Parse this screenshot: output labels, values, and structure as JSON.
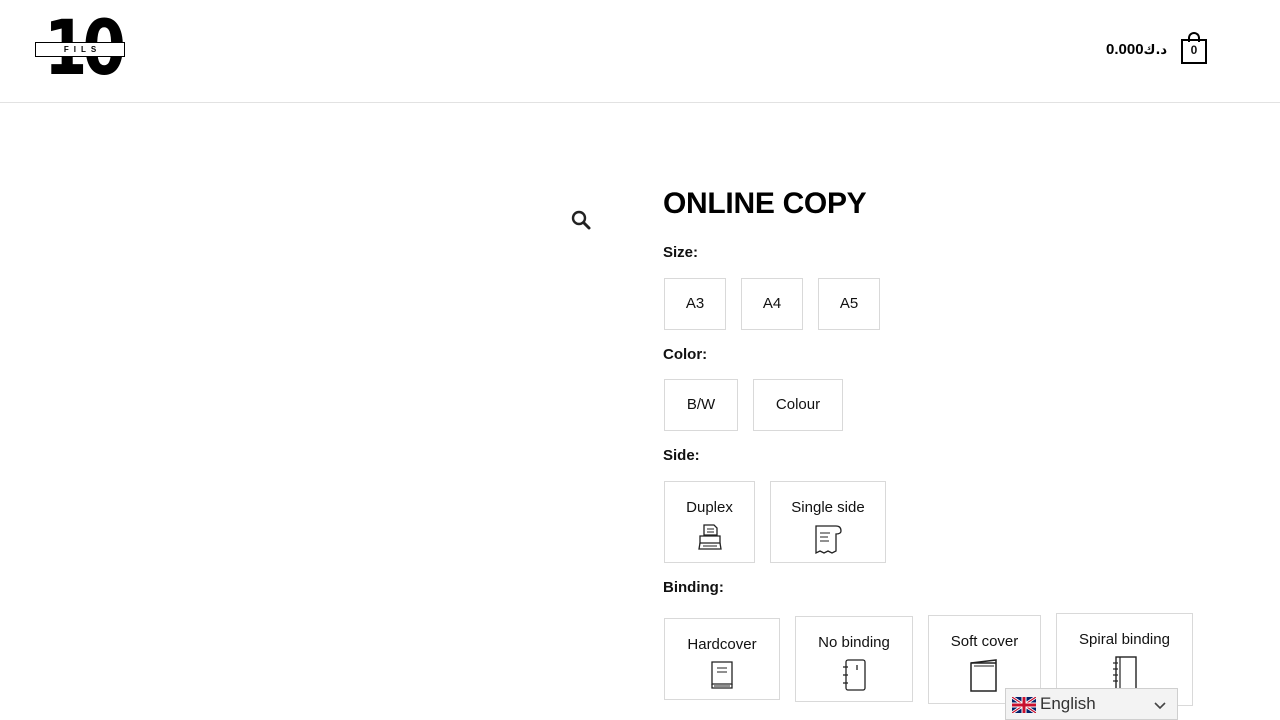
{
  "header": {
    "logo": {
      "digits": "10",
      "word": "FILS"
    },
    "cart": {
      "total": "0.000",
      "currency": "د.ك",
      "count": "0"
    }
  },
  "product": {
    "title": "ONLINE COPY",
    "attributes": {
      "size": {
        "label": "Size:",
        "options": [
          "A3",
          "A4",
          "A5"
        ]
      },
      "color": {
        "label": "Color:",
        "options": [
          "B/W",
          "Colour"
        ]
      },
      "side": {
        "label": "Side:",
        "options": [
          "Duplex",
          "Single side"
        ]
      },
      "binding": {
        "label": "Binding:",
        "options": [
          "Hardcover",
          "No binding",
          "Soft cover",
          "Spiral binding"
        ]
      }
    }
  },
  "language": {
    "selected": "English"
  },
  "icons": {
    "zoom": "magnifier-icon",
    "cart": "shopping-bag-icon",
    "duplex": "printer-icon",
    "single_side": "paper-sheet-icon",
    "hardcover": "book-icon",
    "no_binding": "notebook-icon",
    "soft_cover": "soft-cover-icon",
    "spiral": "spiral-notebook-icon",
    "language_flag": "uk-flag-icon",
    "dropdown": "chevron-down-icon"
  }
}
